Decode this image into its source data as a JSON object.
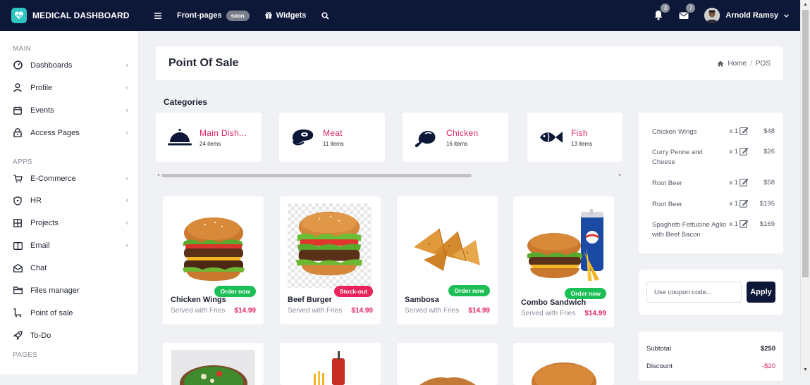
{
  "brand": {
    "name": "MEDICAL DASHBOARD"
  },
  "topbar": {
    "menu_icon": "hamburger-icon",
    "frontpages": "Front-pages",
    "soon": "soon",
    "widgets": "Widgets",
    "search_icon": "search-icon",
    "notif_count": "3",
    "msg_count": "7",
    "user_name": "Arnold Ramsy"
  },
  "sidebar": {
    "sec_main": "MAIN",
    "sec_apps": "APPS",
    "sec_pages": "PAGES",
    "main_items": [
      {
        "label": "Dashboards",
        "icon": "gauge-icon"
      },
      {
        "label": "Profile",
        "icon": "user-icon"
      },
      {
        "label": "Events",
        "icon": "calendar-icon"
      },
      {
        "label": "Access Pages",
        "icon": "lock-icon"
      }
    ],
    "app_items": [
      {
        "label": "E-Commerce",
        "icon": "cart-icon"
      },
      {
        "label": "HR",
        "icon": "shield-icon"
      },
      {
        "label": "Projects",
        "icon": "grid-icon"
      },
      {
        "label": "Email",
        "icon": "mail-icon"
      },
      {
        "label": "Chat",
        "icon": "envelope-open-icon"
      },
      {
        "label": "Files manager",
        "icon": "folder-icon"
      },
      {
        "label": "Point of sale",
        "icon": "pos-cart-icon"
      },
      {
        "label": "To-Do",
        "icon": "rocket-icon"
      }
    ]
  },
  "page": {
    "title": "Point Of Sale",
    "breadcrumb_home": "Home",
    "breadcrumb_sep": "/",
    "breadcrumb_current": "POS",
    "categories_title": "Categories"
  },
  "categories": [
    {
      "name": "Main Dish...",
      "count": "24 items",
      "icon": "cloche-icon"
    },
    {
      "name": "Meat",
      "count": "11 items",
      "icon": "steak-icon"
    },
    {
      "name": "Chicken",
      "count": "16 items",
      "icon": "chicken-leg-icon"
    },
    {
      "name": "Fish",
      "count": "13 items",
      "icon": "fish-icon"
    }
  ],
  "products": [
    {
      "name": "Chicken Wings",
      "sub": "Served with Fries",
      "price": "$14.99",
      "tag": "Order now",
      "tag_color": "#1cbf56"
    },
    {
      "name": "Beef Burger",
      "sub": "Served with Fries",
      "price": "$14.99",
      "tag": "Stock-out",
      "tag_color": "#e8245a"
    },
    {
      "name": "Sambosa",
      "sub": "Served with Fries",
      "price": "$14.99",
      "tag": "Order now",
      "tag_color": "#1cbf56"
    },
    {
      "name": "Combo Sandwich",
      "sub": "Served with Fries",
      "price": "$14.99",
      "tag": "Order now",
      "tag_color": "#1cbf56"
    }
  ],
  "cart": [
    {
      "name": "Chicken Wings",
      "qty": "x 1",
      "price": "$48"
    },
    {
      "name": "Curry Penne and Cheese",
      "qty": "x 1",
      "price": "$26"
    },
    {
      "name": "Root Beer",
      "qty": "x 1",
      "price": "$58"
    },
    {
      "name": "Root Beer",
      "qty": "x 1",
      "price": "$195"
    },
    {
      "name": "Spaghetti Fettucine Aglio with Beef Bacon",
      "qty": "x 1",
      "price": "$169"
    }
  ],
  "coupon": {
    "placeholder": "Use coupon code...",
    "apply": "Apply"
  },
  "totals": {
    "subtotal_label": "Subtotal",
    "subtotal": "$250",
    "discount_label": "Discount",
    "discount": "-$20"
  },
  "colors": {
    "navy": "#0d1838",
    "accent": "#e0245e",
    "green": "#1cbf56"
  }
}
